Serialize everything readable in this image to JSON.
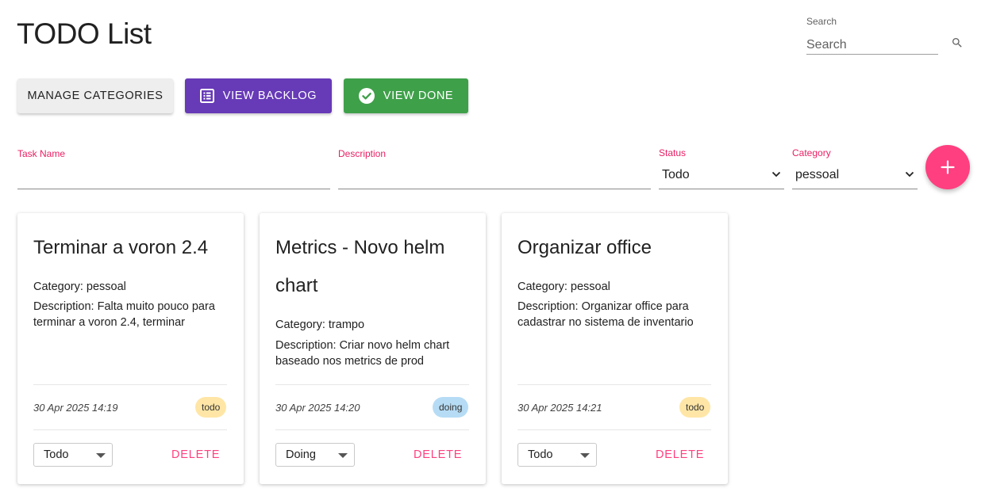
{
  "header": {
    "title": "TODO List"
  },
  "search": {
    "label": "Search",
    "placeholder": "Search",
    "value": ""
  },
  "toolbar": {
    "manage_categories_label": "MANAGE CATEGORIES",
    "view_backlog_label": "VIEW BACKLOG",
    "view_done_label": "VIEW DONE"
  },
  "form": {
    "task_name_label": "Task Name",
    "task_name_value": "",
    "description_label": "Description",
    "description_value": "",
    "status_label": "Status",
    "status_value": "Todo",
    "category_label": "Category",
    "category_value": "pessoal",
    "add_icon": "plus-icon"
  },
  "colors": {
    "accent": "#ff3f7f",
    "backlog": "#673ab7",
    "done": "#3fa04a",
    "badge_todo": "#ffe6a6",
    "badge_doing": "#b6dcf5"
  },
  "tasks": [
    {
      "title": "Terminar a voron 2.4",
      "category": "Category: pessoal",
      "description": "Description: Falta muito pouco para terminar a voron 2.4, terminar",
      "date": "30 Apr 2025 14:19",
      "badge": "todo",
      "status": "Todo",
      "delete_label": "DELETE"
    },
    {
      "title": "Metrics - Novo helm chart",
      "category": "Category: trampo",
      "description": "Description: Criar novo helm chart baseado nos metrics de prod",
      "date": "30 Apr 2025 14:20",
      "badge": "doing",
      "status": "Doing",
      "delete_label": "DELETE"
    },
    {
      "title": "Organizar office",
      "category": "Category: pessoal",
      "description": "Description: Organizar office para cadastrar no sistema de inventario",
      "date": "30 Apr 2025 14:21",
      "badge": "todo",
      "status": "Todo",
      "delete_label": "DELETE"
    }
  ]
}
